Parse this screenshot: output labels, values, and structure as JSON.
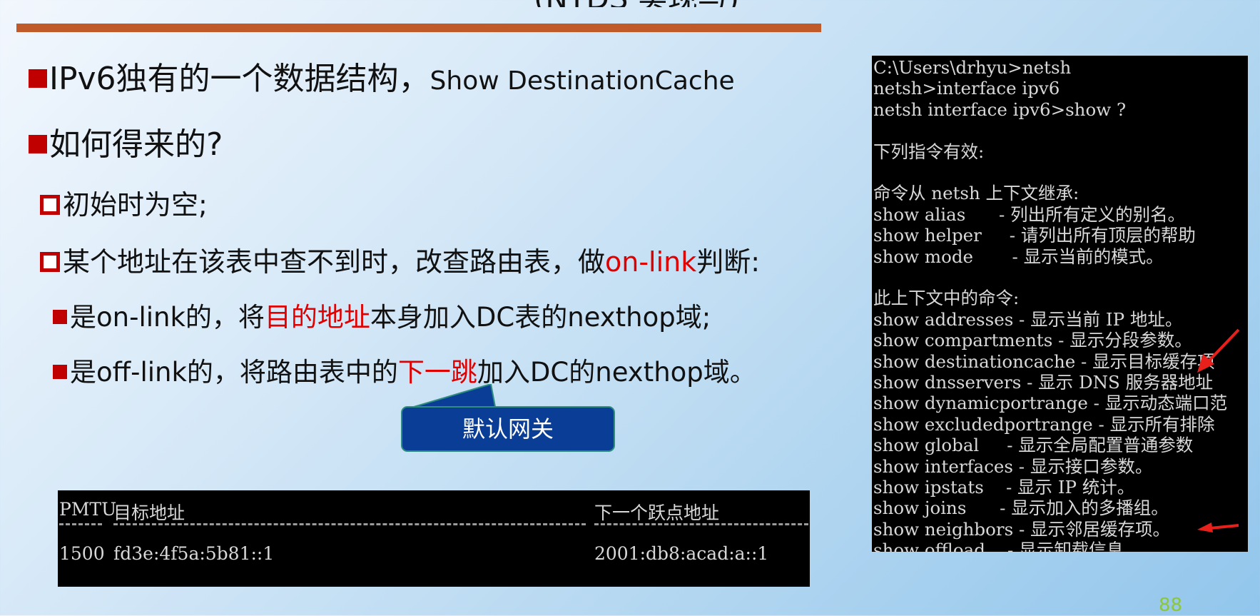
{
  "slide": {
    "title_partial": "(NTDS 实现与)",
    "bullets": {
      "b1_text": "IPv6独有的一个数据结构，",
      "b1_en": "Show DestinationCache",
      "b2_text": "如何得来的?",
      "b3_text": "初始时为空;",
      "b4_pre": "某个地址在该表中查不到时，改查路由表，做",
      "b4_red": "on-link",
      "b4_post": "判断:",
      "b5_pre": "是on-link的，将",
      "b5_red": "目的地址",
      "b5_post": "本身加入DC表的nexthop域;",
      "b6_pre": "是off-link的，将路由表中的",
      "b6_red": "下一跳",
      "b6_post": "加入DC的nexthop域。"
    },
    "callout_label": "默认网关",
    "page_number": "88"
  },
  "dc_table": {
    "headers": [
      "PMTU",
      "目标地址",
      "下一个跃点地址"
    ],
    "rows": [
      [
        "1500",
        "fd3e:4f5a:5b81::1",
        "2001:db8:acad:a::1"
      ]
    ]
  },
  "terminal": {
    "lines": [
      "C:\\Users\\drhyu>netsh",
      "netsh>interface ipv6",
      "netsh interface ipv6>show ?",
      "",
      "下列指令有效:",
      "",
      "命令从 netsh 上下文继承:",
      "show alias      - 列出所有定义的别名。",
      "show helper     - 请列出所有顶层的帮助",
      "show mode       - 显示当前的模式。",
      "",
      "此上下文中的命令:",
      "show addresses - 显示当前 IP 地址。",
      "show compartments - 显示分段参数。",
      "show destinationcache - 显示目标缓存项",
      "show dnsservers - 显示 DNS 服务器地址",
      "show dynamicportrange - 显示动态端口范",
      "show excludedportrange - 显示所有排除",
      "show global     - 显示全局配置普通参数",
      "show interfaces - 显示接口参数。",
      "show ipstats    - 显示 IP 统计。",
      "show joins      - 显示加入的多播组。",
      "show neighbors - 显示邻居缓存项。",
      "show offload    - 显示卸载信息"
    ]
  },
  "colors": {
    "accent_red": "#e00000",
    "bullet_red": "#c00000",
    "rule": "#c05a28",
    "callout_bg": "#0a3d95",
    "arrow": "#e8201c",
    "page_number": "#8cc63e"
  }
}
